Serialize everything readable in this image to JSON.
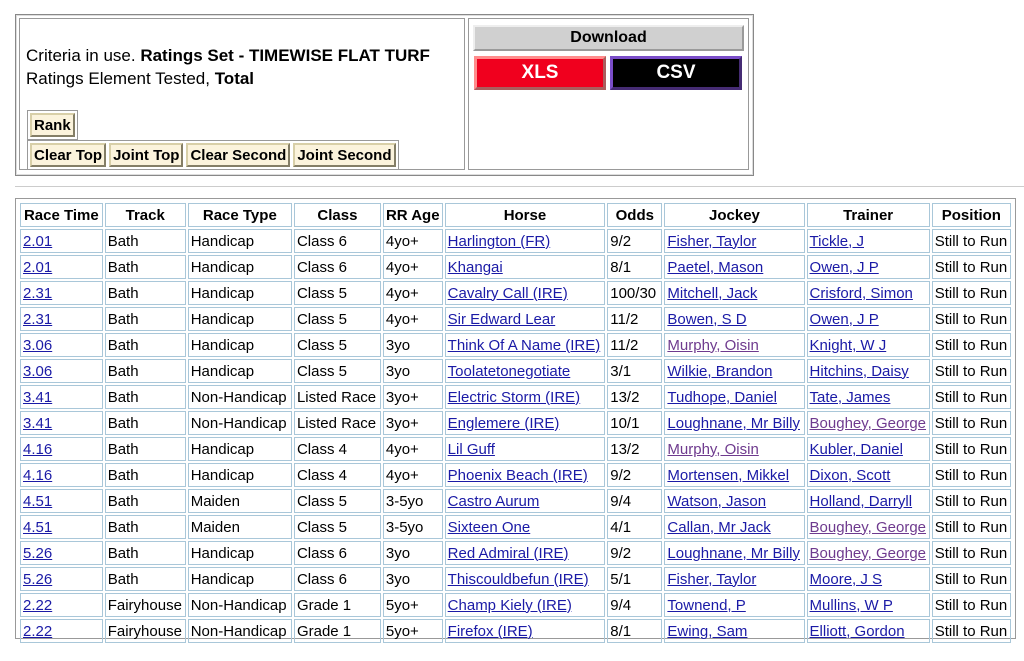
{
  "criteria": {
    "line1_prefix": "Criteria in use. ",
    "line1_value": "Ratings Set - TIMEWISE FLAT TURF",
    "line2_prefix": "Ratings Element Tested, ",
    "line2_value": "Total"
  },
  "buttons": {
    "rank": "Rank",
    "filters": [
      "Clear Top",
      "Joint Top",
      "Clear Second",
      "Joint Second"
    ]
  },
  "download": {
    "title": "Download",
    "xls": "XLS",
    "csv": "CSV",
    "colors": {
      "xls": "#f0001e",
      "csv": "#000000"
    }
  },
  "table": {
    "headers": [
      "Race Time",
      "Track",
      "Race Type",
      "Class",
      "RR Age",
      "Horse",
      "Odds",
      "Jockey",
      "Trainer",
      "Position"
    ],
    "rows": [
      {
        "time": "2.01",
        "track": "Bath",
        "type": "Handicap",
        "class": "Class 6",
        "age": "4yo+",
        "horse": "Harlington (FR)",
        "odds": "9/2",
        "jockey": "Fisher, Taylor",
        "trainer": "Tickle, J",
        "position": "Still to Run"
      },
      {
        "time": "2.01",
        "track": "Bath",
        "type": "Handicap",
        "class": "Class 6",
        "age": "4yo+",
        "horse": "Khangai",
        "odds": "8/1",
        "jockey": "Paetel, Mason",
        "trainer": "Owen, J P",
        "position": "Still to Run"
      },
      {
        "time": "2.31",
        "track": "Bath",
        "type": "Handicap",
        "class": "Class 5",
        "age": "4yo+",
        "horse": "Cavalry Call (IRE)",
        "odds": "100/30",
        "jockey": "Mitchell, Jack",
        "trainer": "Crisford, Simon",
        "position": "Still to Run"
      },
      {
        "time": "2.31",
        "track": "Bath",
        "type": "Handicap",
        "class": "Class 5",
        "age": "4yo+",
        "horse": "Sir Edward Lear",
        "odds": "11/2",
        "jockey": "Bowen, S D",
        "trainer": "Owen, J P",
        "position": "Still to Run"
      },
      {
        "time": "3.06",
        "track": "Bath",
        "type": "Handicap",
        "class": "Class 5",
        "age": "3yo",
        "horse": "Think Of A Name (IRE)",
        "odds": "11/2",
        "jockey": "Murphy, Oisin",
        "trainer": "Knight, W J",
        "position": "Still to Run",
        "jockey_visited": true
      },
      {
        "time": "3.06",
        "track": "Bath",
        "type": "Handicap",
        "class": "Class 5",
        "age": "3yo",
        "horse": "Toolatetonegotiate",
        "odds": "3/1",
        "jockey": "Wilkie, Brandon",
        "trainer": "Hitchins, Daisy",
        "position": "Still to Run"
      },
      {
        "time": "3.41",
        "track": "Bath",
        "type": "Non-Handicap",
        "class": "Listed Race",
        "age": "3yo+",
        "horse": "Electric Storm (IRE)",
        "odds": "13/2",
        "jockey": "Tudhope, Daniel",
        "trainer": "Tate, James",
        "position": "Still to Run"
      },
      {
        "time": "3.41",
        "track": "Bath",
        "type": "Non-Handicap",
        "class": "Listed Race",
        "age": "3yo+",
        "horse": "Englemere (IRE)",
        "odds": "10/1",
        "jockey": "Loughnane, Mr Billy",
        "trainer": "Boughey, George",
        "position": "Still to Run",
        "trainer_visited": true
      },
      {
        "time": "4.16",
        "track": "Bath",
        "type": "Handicap",
        "class": "Class 4",
        "age": "4yo+",
        "horse": "Lil Guff",
        "odds": "13/2",
        "jockey": "Murphy, Oisin",
        "trainer": "Kubler, Daniel",
        "position": "Still to Run",
        "jockey_visited": true
      },
      {
        "time": "4.16",
        "track": "Bath",
        "type": "Handicap",
        "class": "Class 4",
        "age": "4yo+",
        "horse": "Phoenix Beach (IRE)",
        "odds": "9/2",
        "jockey": "Mortensen, Mikkel",
        "trainer": "Dixon, Scott",
        "position": "Still to Run"
      },
      {
        "time": "4.51",
        "track": "Bath",
        "type": "Maiden",
        "class": "Class 5",
        "age": "3-5yo",
        "horse": "Castro Aurum",
        "odds": "9/4",
        "jockey": "Watson, Jason",
        "trainer": "Holland, Darryll",
        "position": "Still to Run"
      },
      {
        "time": "4.51",
        "track": "Bath",
        "type": "Maiden",
        "class": "Class 5",
        "age": "3-5yo",
        "horse": "Sixteen One",
        "odds": "4/1",
        "jockey": "Callan, Mr Jack",
        "trainer": "Boughey, George",
        "position": "Still to Run",
        "trainer_visited": true
      },
      {
        "time": "5.26",
        "track": "Bath",
        "type": "Handicap",
        "class": "Class 6",
        "age": "3yo",
        "horse": "Red Admiral (IRE)",
        "odds": "9/2",
        "jockey": "Loughnane, Mr Billy",
        "trainer": "Boughey, George",
        "position": "Still to Run",
        "trainer_visited": true
      },
      {
        "time": "5.26",
        "track": "Bath",
        "type": "Handicap",
        "class": "Class 6",
        "age": "3yo",
        "horse": "Thiscouldbefun (IRE)",
        "odds": "5/1",
        "jockey": "Fisher, Taylor",
        "trainer": "Moore, J S",
        "position": "Still to Run"
      },
      {
        "time": "2.22",
        "track": "Fairyhouse",
        "type": "Non-Handicap",
        "class": "Grade 1",
        "age": "5yo+",
        "horse": "Champ Kiely (IRE)",
        "odds": "9/4",
        "jockey": "Townend, P",
        "trainer": "Mullins, W P",
        "position": "Still to Run"
      },
      {
        "time": "2.22",
        "track": "Fairyhouse",
        "type": "Non-Handicap",
        "class": "Grade 1",
        "age": "5yo+",
        "horse": "Firefox (IRE)",
        "odds": "8/1",
        "jockey": "Ewing, Sam",
        "trainer": "Elliott, Gordon",
        "position": "Still to Run"
      }
    ]
  }
}
